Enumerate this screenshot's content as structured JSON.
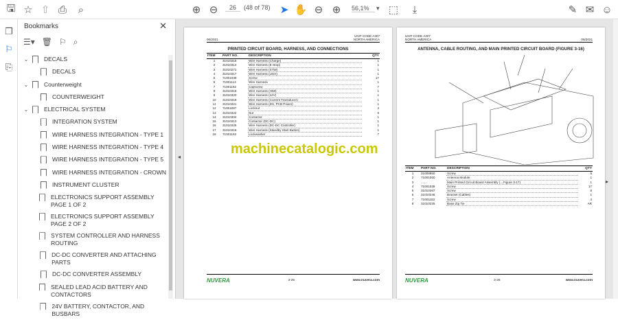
{
  "toolbar": {
    "page_current": "26",
    "page_of": "(48 of 78)",
    "zoom": "56,1%"
  },
  "bookmarks": {
    "title": "Bookmarks",
    "items": [
      {
        "label": "DECALS",
        "level": 0,
        "expanded": true
      },
      {
        "label": "DECALS",
        "level": 1
      },
      {
        "label": "Counterweight",
        "level": 0,
        "expanded": true
      },
      {
        "label": "COUNTERWEIGHT",
        "level": 1
      },
      {
        "label": "ELECTRICAL SYSTEM",
        "level": 0,
        "expanded": true
      },
      {
        "label": "INTEGRATION SYSTEM",
        "level": 1
      },
      {
        "label": "WIRE HARNESS INTEGRATION - TYPE 1",
        "level": 1
      },
      {
        "label": "WIRE HARNESS INTEGRATION - TYPE 4",
        "level": 1
      },
      {
        "label": "WIRE HARNESS INTEGRATION - TYPE 5",
        "level": 1
      },
      {
        "label": "WIRE HARNESS INTEGRATION - CROWN",
        "level": 1
      },
      {
        "label": "INSTRUMENT CLUSTER",
        "level": 1
      },
      {
        "label": "ELECTRONICS SUPPORT ASSEMBLY PAGE 1 OF 2",
        "level": 1
      },
      {
        "label": "ELECTRONICS SUPPORT ASSEMBLY PAGE 2 OF 2",
        "level": 1
      },
      {
        "label": "SYSTEM CONTROLLER AND HARNESS ROUTING",
        "level": 1
      },
      {
        "label": "DC-DC CONVERTER AND ATTACHING PARTS",
        "level": 1
      },
      {
        "label": "DC-DC CONVERTER ASSEMBLY",
        "level": 1
      },
      {
        "label": "SEALED LEAD ACID BATTERY AND CONTACTORS",
        "level": 1
      },
      {
        "label": "24V BATTERY, CONTACTOR, AND BUSBARS",
        "level": 1
      }
    ]
  },
  "left_page": {
    "date": "06/2021",
    "unit": "UNIT CODE A307",
    "region": "NORTH AMERICA",
    "title": "PRINTED CIRCUIT BOARD, HARNESS, AND CONNECTIONS",
    "headers": [
      "ITEM",
      "PART NO.",
      "DESCRIPTION",
      "QTY"
    ],
    "rows": [
      [
        "1",
        "31010315",
        "Wire Harness (Charge)",
        "1"
      ],
      [
        "2",
        "31010314",
        "Wire Harness (E-Stop)",
        "1"
      ],
      [
        "3",
        "31010271",
        "Wire Harness (STW)",
        "1"
      ],
      [
        "4",
        "31010317",
        "Wire Harness (User)",
        "1"
      ],
      [
        "5",
        "71001039",
        "Screw",
        "17"
      ],
      [
        "6",
        "71001114",
        "Wire Harness",
        "1"
      ],
      [
        "7",
        "71001162",
        "Capscrew",
        "7"
      ],
      [
        "8",
        "31010318",
        "Wire Harness (HMI)",
        "1"
      ],
      [
        "9",
        "31010320",
        "Wire Harness (12V)",
        "1"
      ],
      [
        "10",
        "31010319",
        "Wire Harness (Current Transducer)",
        "1"
      ],
      [
        "11",
        "31010321",
        "Wire Harness (DS, PCB Power)",
        "1"
      ],
      [
        "12",
        "71001067",
        "Locknut",
        "4"
      ],
      [
        "13",
        "31010322",
        "Nut",
        "6"
      ],
      [
        "14",
        "31010304",
        "Contactor",
        "1"
      ],
      [
        "15",
        "31010313",
        "Contactor (DC-DC)",
        "1"
      ],
      [
        "16",
        "31010325",
        "Wire Harness (DC-DC Controller)",
        "1"
      ],
      [
        "17",
        "31010316",
        "Wire Harness (Standby Start Button)",
        "1"
      ],
      [
        "18",
        "71001163",
        "Lockwasher",
        "7"
      ]
    ],
    "brand": "NUVERA",
    "page_no": "3-25",
    "url": "www.nuvera.com"
  },
  "right_page": {
    "date": "06/2021",
    "unit": "UNIT CODE A307",
    "region": "NORTH AMERICA",
    "title": "ANTENNA, CABLE ROUTING, AND MAIN PRINTED CIRCUIT BOARD (FIGURE 3-16)",
    "headers": [
      "ITEM",
      "PART NO.",
      "DESCRIPTION",
      "QTY"
    ],
    "rows": [
      [
        "1",
        "31009950",
        "Screw",
        "6"
      ],
      [
        "2",
        "71001060",
        "Antenna Module",
        "1"
      ],
      [
        "3",
        "......",
        "Main Printed Circuit Board Assembly (→Figure 3-17)",
        "1"
      ],
      [
        "4",
        "71001039",
        "Screw",
        "17"
      ],
      [
        "5",
        "31010267",
        "Screw",
        "8"
      ],
      [
        "6",
        "31010246",
        "Bracket (Cables)",
        "1"
      ],
      [
        "7",
        "71001153",
        "Screw",
        "4"
      ],
      [
        "8",
        "31010225",
        "Base Zip Tie",
        "AR"
      ]
    ],
    "brand": "NUVERA",
    "page_no": "3-26",
    "url": "www.nuvera.com"
  },
  "watermark": "machinecatalogic.com"
}
